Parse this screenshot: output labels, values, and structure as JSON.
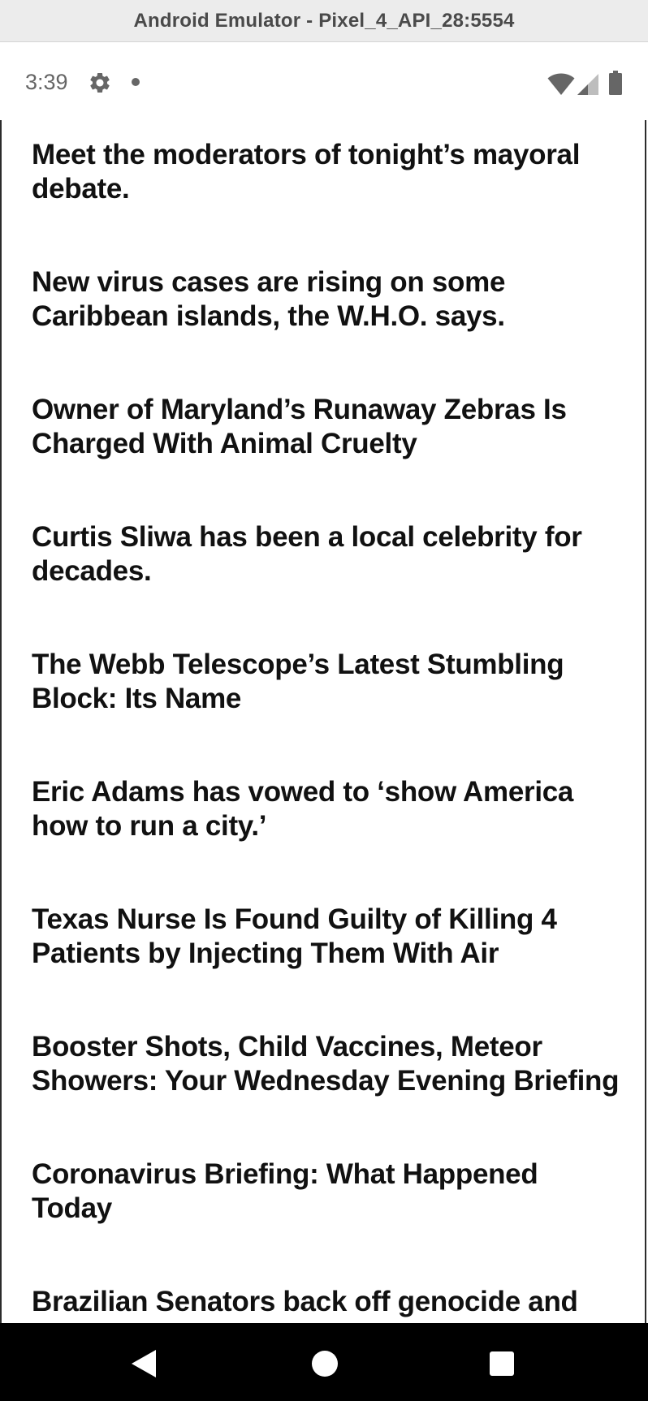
{
  "window": {
    "title": "Android Emulator - Pixel_4_API_28:5554"
  },
  "status_bar": {
    "time": "3:39",
    "icons": [
      "gear-icon",
      "notification-dot-icon",
      "wifi-icon",
      "cellular-signal-icon",
      "battery-icon"
    ]
  },
  "feed": {
    "headlines": [
      {
        "text": "Meet the moderators of tonight’s mayoral debate."
      },
      {
        "text": "New virus cases are rising on some Caribbean islands, the W.H.O. says."
      },
      {
        "text": "Owner of Maryland’s Runaway Zebras Is Charged With Animal Cruelty"
      },
      {
        "text": "Curtis Sliwa has been a local celebrity for decades."
      },
      {
        "text": "The Webb Telescope’s Latest Stumbling Block: Its Name"
      },
      {
        "text": "Eric Adams has vowed to ‘show America how to run a city.’"
      },
      {
        "text": "Texas Nurse Is Found Guilty of Killing 4 Patients by Injecting Them With Air"
      },
      {
        "text": "Booster Shots, Child Vaccines, Meteor Showers: Your Wednesday Evening Briefing"
      },
      {
        "text": "Coronavirus Briefing: What Happened Today"
      },
      {
        "text": "Brazilian Senators back off genocide and"
      }
    ]
  },
  "nav_bar": {
    "buttons": [
      "back-icon",
      "home-icon",
      "recents-icon"
    ]
  }
}
